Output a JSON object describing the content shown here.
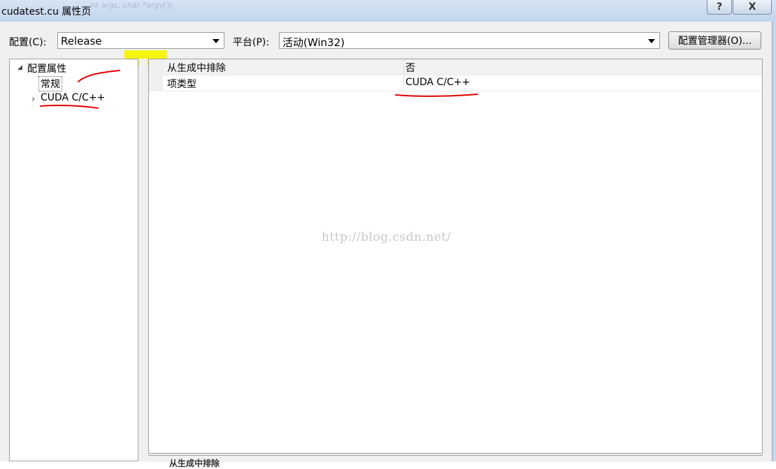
{
  "window": {
    "title": "cudatest.cu 属性页",
    "background_snippet": "nt argc, char *argv[])",
    "help_label": "?",
    "close_label": "X"
  },
  "toolbar": {
    "config_label": "配置(C):",
    "config_value": "Release",
    "platform_label": "平台(P):",
    "platform_value": "活动(Win32)",
    "config_manager_button": "配置管理器(O)..."
  },
  "tree": {
    "root": {
      "expander": "◢",
      "label": "配置属性"
    },
    "items": [
      {
        "label": "常规",
        "selected": true
      },
      {
        "expander": "›",
        "label": "CUDA C/C++"
      }
    ]
  },
  "grid": {
    "rows": [
      {
        "name": "从生成中排除",
        "value": "否"
      },
      {
        "name": "项类型",
        "value": "CUDA C/C++"
      }
    ]
  },
  "description": {
    "title": "从生成中排除"
  },
  "watermark": "http://blog.csdn.net/",
  "colors": {
    "annotation": "#e00000",
    "highlight": "#f4f40f",
    "titlebar": "#c8d8ee"
  }
}
